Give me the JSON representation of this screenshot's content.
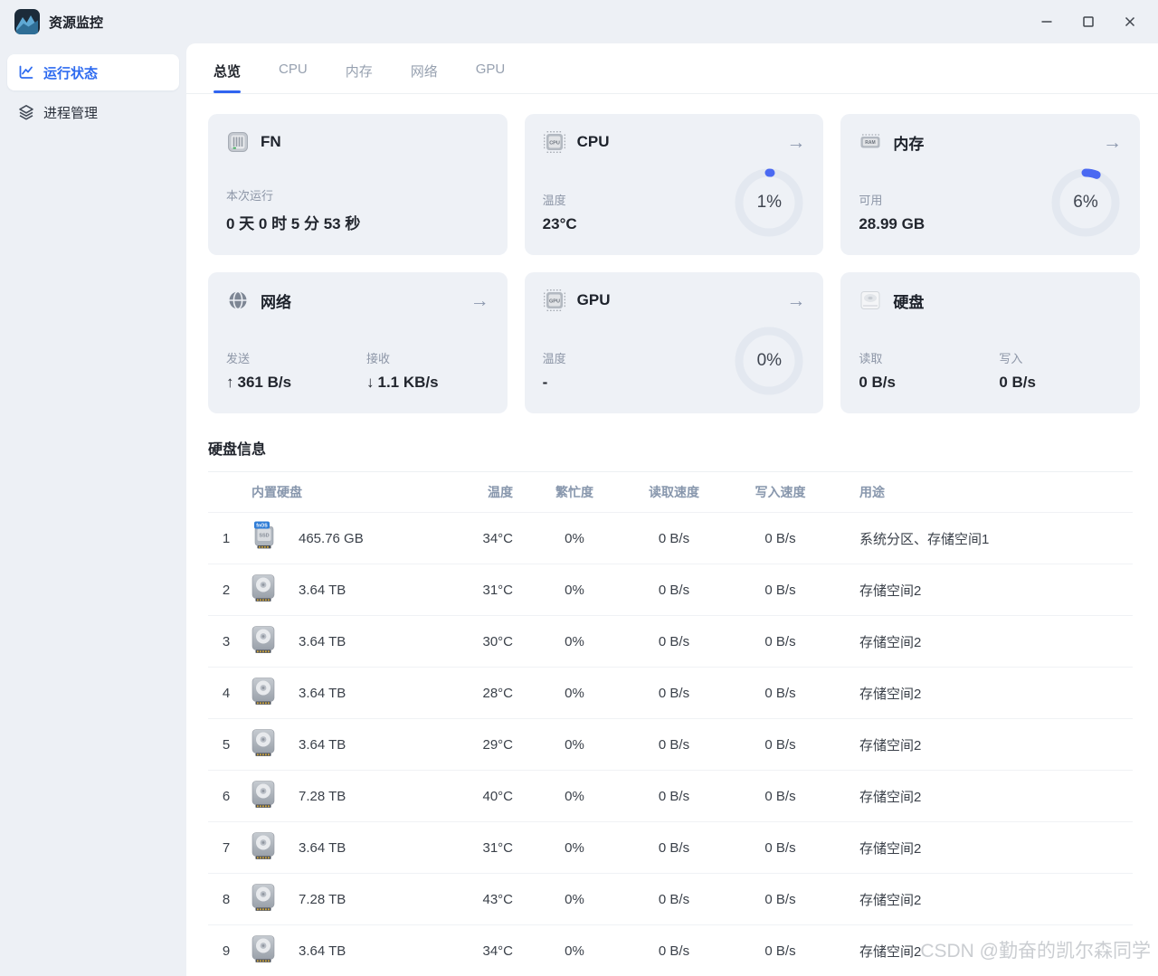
{
  "window": {
    "title": "资源监控"
  },
  "sidebar": {
    "items": [
      {
        "label": "运行状态"
      },
      {
        "label": "进程管理"
      }
    ]
  },
  "tabs": [
    {
      "label": "总览"
    },
    {
      "label": "CPU"
    },
    {
      "label": "内存"
    },
    {
      "label": "网络"
    },
    {
      "label": "GPU"
    }
  ],
  "cards": {
    "fn": {
      "title": "FN",
      "label": "本次运行",
      "value": "0 天 0 时 5 分 53 秒"
    },
    "cpu": {
      "title": "CPU",
      "label": "温度",
      "value": "23°C",
      "percent": 1,
      "percent_label": "1%"
    },
    "memory": {
      "title": "内存",
      "label": "可用",
      "value": "28.99 GB",
      "percent": 6,
      "percent_label": "6%"
    },
    "network": {
      "title": "网络",
      "send_label": "发送",
      "send_arrow": "↑",
      "send_value": "361 B/s",
      "recv_label": "接收",
      "recv_arrow": "↓",
      "recv_value": "1.1 KB/s"
    },
    "gpu": {
      "title": "GPU",
      "label": "温度",
      "value": "-",
      "percent": 0,
      "percent_label": "0%"
    },
    "disk": {
      "title": "硬盘",
      "read_label": "读取",
      "read_value": "0 B/s",
      "write_label": "写入",
      "write_value": "0 B/s"
    }
  },
  "chip_labels": {
    "cpu": "CPU",
    "ram": "RAM",
    "gpu": "GPU"
  },
  "ssd_badge": {
    "brand": "fnOS",
    "type": "SSD"
  },
  "disk_section": {
    "title": "硬盘信息",
    "headers": {
      "drive": "内置硬盘",
      "temp": "温度",
      "busy": "繁忙度",
      "read": "读取速度",
      "write": "写入速度",
      "usage": "用途"
    },
    "rows": [
      {
        "index": "1",
        "icon": "ssd",
        "size": "465.76 GB",
        "temp": "34°C",
        "busy": "0%",
        "read": "0 B/s",
        "write": "0 B/s",
        "usage": "系统分区、存储空间1"
      },
      {
        "index": "2",
        "icon": "hdd",
        "size": "3.64 TB",
        "temp": "31°C",
        "busy": "0%",
        "read": "0 B/s",
        "write": "0 B/s",
        "usage": "存储空间2"
      },
      {
        "index": "3",
        "icon": "hdd",
        "size": "3.64 TB",
        "temp": "30°C",
        "busy": "0%",
        "read": "0 B/s",
        "write": "0 B/s",
        "usage": "存储空间2"
      },
      {
        "index": "4",
        "icon": "hdd",
        "size": "3.64 TB",
        "temp": "28°C",
        "busy": "0%",
        "read": "0 B/s",
        "write": "0 B/s",
        "usage": "存储空间2"
      },
      {
        "index": "5",
        "icon": "hdd",
        "size": "3.64 TB",
        "temp": "29°C",
        "busy": "0%",
        "read": "0 B/s",
        "write": "0 B/s",
        "usage": "存储空间2"
      },
      {
        "index": "6",
        "icon": "hdd",
        "size": "7.28 TB",
        "temp": "40°C",
        "busy": "0%",
        "read": "0 B/s",
        "write": "0 B/s",
        "usage": "存储空间2"
      },
      {
        "index": "7",
        "icon": "hdd",
        "size": "3.64 TB",
        "temp": "31°C",
        "busy": "0%",
        "read": "0 B/s",
        "write": "0 B/s",
        "usage": "存储空间2"
      },
      {
        "index": "8",
        "icon": "hdd",
        "size": "7.28 TB",
        "temp": "43°C",
        "busy": "0%",
        "read": "0 B/s",
        "write": "0 B/s",
        "usage": "存储空间2"
      },
      {
        "index": "9",
        "icon": "hdd",
        "size": "3.64 TB",
        "temp": "34°C",
        "busy": "0%",
        "read": "0 B/s",
        "write": "0 B/s",
        "usage": "存储空间2"
      }
    ]
  },
  "watermark": "CSDN @勤奋的凯尔森同学",
  "colors": {
    "accent_blue": "#3a6af2",
    "page_bg": "#edf0f5",
    "card_bg": "#eef1f6",
    "gauge_track": "#e3e8f0",
    "muted_text": "#8d96a7",
    "table_header_text": "#8897ad"
  }
}
